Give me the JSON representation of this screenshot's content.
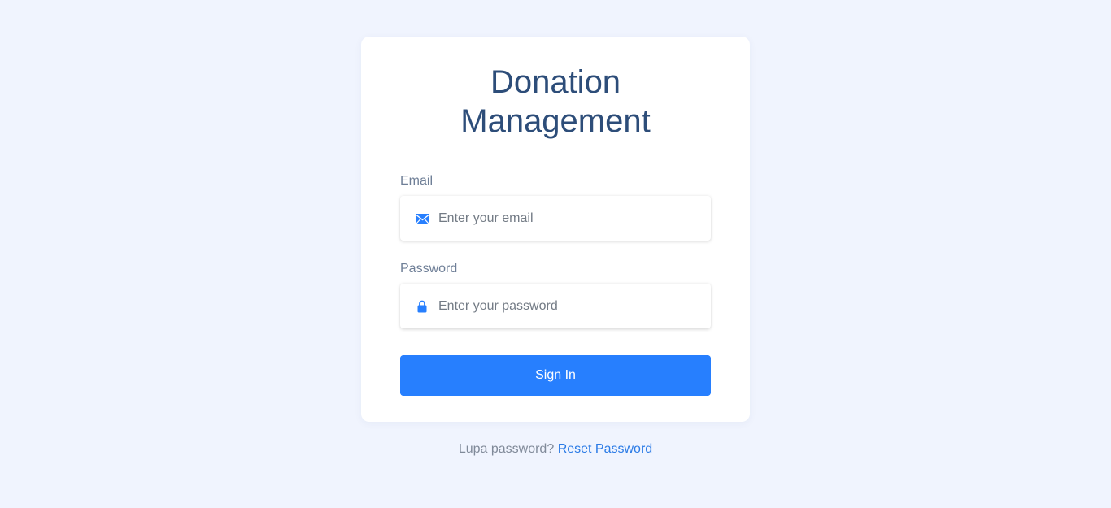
{
  "login": {
    "title_line1": "Donation",
    "title_line2": "Management",
    "email": {
      "label": "Email",
      "placeholder": "Enter your email",
      "value": "",
      "icon": "envelope-icon"
    },
    "password": {
      "label": "Password",
      "placeholder": "Enter your password",
      "value": "",
      "icon": "lock-icon"
    },
    "signin_label": "Sign In"
  },
  "footer": {
    "prompt": "Lupa password?",
    "reset_link": "Reset Password"
  },
  "colors": {
    "background": "#f0f4fe",
    "title": "#2d4d79",
    "accent": "#277ffe",
    "link": "#2b7be6"
  }
}
